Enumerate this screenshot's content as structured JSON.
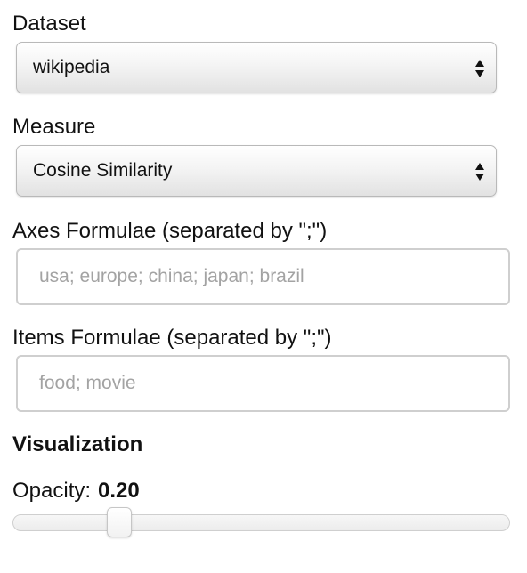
{
  "dataset": {
    "label": "Dataset",
    "selected": "wikipedia",
    "icon": "updown-arrows-icon"
  },
  "measure": {
    "label": "Measure",
    "selected": "Cosine Similarity",
    "icon": "updown-arrows-icon"
  },
  "axes": {
    "label": "Axes Formulae (separated by \";\")",
    "value": "",
    "placeholder": "usa; europe; china; japan; brazil"
  },
  "items": {
    "label": "Items Formulae (separated by \";\")",
    "value": "",
    "placeholder": "food; movie"
  },
  "visualization": {
    "title": "Visualization",
    "opacity_label": "Opacity:",
    "opacity_value": "0.20",
    "opacity_fraction": 0.2
  }
}
